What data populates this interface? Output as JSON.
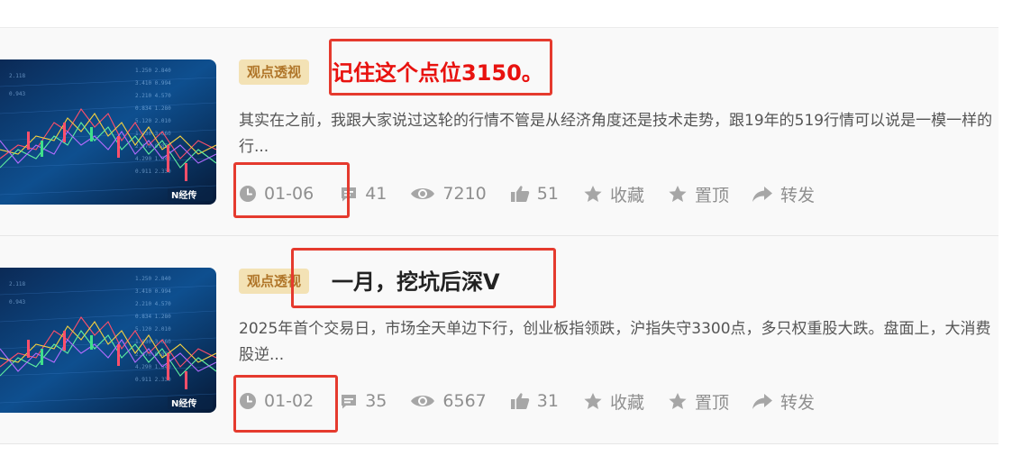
{
  "articles": [
    {
      "tag": "观点透视",
      "title": "记住这个点位3150。",
      "summary": "其实在之前，我跟大家说过这轮的行情不管是从经济角度还是技术走势，跟19年的519行情可以说是一模一样的行...",
      "thumbnail_watermark": "经传",
      "meta": {
        "date": "01-06",
        "comments": "41",
        "views": "7210",
        "likes": "51",
        "favorite_label": "收藏",
        "pin_label": "置顶",
        "share_label": "转发"
      }
    },
    {
      "tag": "观点透视",
      "title": "一月，挖坑后深V",
      "summary": "2025年首个交易日，市场全天单边下行，创业板指领跌，沪指失守3300点，多只权重股大跌。盘面上，大消费股逆...",
      "thumbnail_watermark": "经传",
      "meta": {
        "date": "01-02",
        "comments": "35",
        "views": "6567",
        "likes": "31",
        "favorite_label": "收藏",
        "pin_label": "置顶",
        "share_label": "转发"
      }
    }
  ],
  "icons": {
    "date": "clock-icon",
    "comments": "comment-icon",
    "views": "eye-icon",
    "likes": "thumbs-up-icon",
    "favorite": "star-icon",
    "pin": "star-icon",
    "share": "share-arrow-icon"
  },
  "colors": {
    "tag_bg": "#f3e2b5",
    "tag_text": "#b0762a",
    "highlight_title": "#e8120f",
    "annotation_box": "#e53a2e",
    "meta_text": "#8f8f8f"
  }
}
